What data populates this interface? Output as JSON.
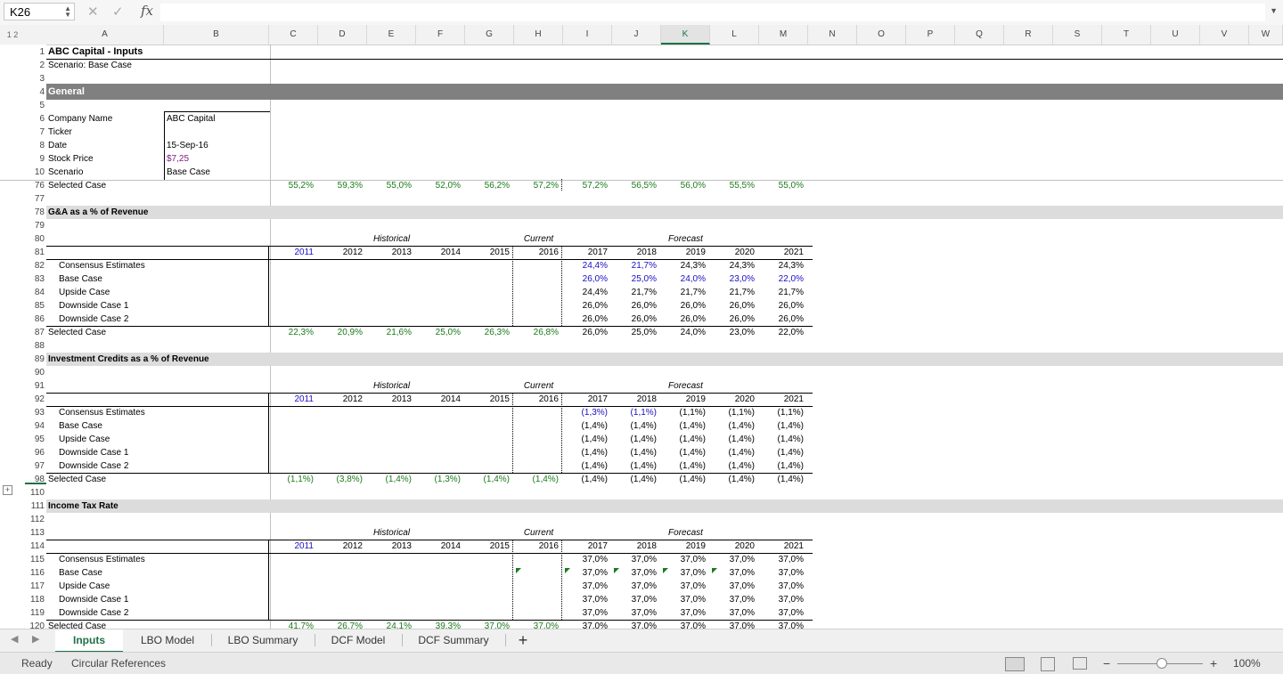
{
  "formula_bar": {
    "name_box": "K26",
    "fx": "fx"
  },
  "columns": [
    "A",
    "B",
    "C",
    "D",
    "E",
    "F",
    "G",
    "H",
    "I",
    "J",
    "K",
    "L",
    "M",
    "N",
    "O",
    "P",
    "Q",
    "R",
    "S",
    "T",
    "U",
    "V",
    "W"
  ],
  "outline_levels": "1 2",
  "frozen": {
    "title": "ABC Capital - Inputs",
    "scenario_line": "Scenario: Base Case",
    "general_header": "General",
    "fields": [
      {
        "label": "Company Name",
        "value": "ABC Capital"
      },
      {
        "label": "Ticker",
        "value": ""
      },
      {
        "label": "Date",
        "value": "15-Sep-16"
      },
      {
        "label": "Stock Price",
        "value": "$7,25"
      },
      {
        "label": "Scenario",
        "value": "Base Case"
      }
    ]
  },
  "top_selected_row": {
    "label": "Selected Case",
    "values": [
      "55,2%",
      "59,3%",
      "55,0%",
      "52,0%",
      "56,2%",
      "57,2%",
      "57,2%",
      "56,5%",
      "56,0%",
      "55,5%",
      "55,0%"
    ]
  },
  "period_labels": {
    "historical": "Historical",
    "current": "Current",
    "forecast": "Forecast"
  },
  "years": [
    "2011",
    "2012",
    "2013",
    "2014",
    "2015",
    "2016",
    "2017",
    "2018",
    "2019",
    "2020",
    "2021"
  ],
  "sections": [
    {
      "title": "G&A as a % of Revenue",
      "cases": [
        {
          "label": "Consensus Estimates",
          "values": [
            "24,4%",
            "21,7%",
            "24,3%",
            "24,3%",
            "24,3%"
          ]
        },
        {
          "label": "Base Case",
          "values": [
            "26,0%",
            "25,0%",
            "24,0%",
            "23,0%",
            "22,0%"
          ]
        },
        {
          "label": "Upside Case",
          "values": [
            "24,4%",
            "21,7%",
            "21,7%",
            "21,7%",
            "21,7%"
          ]
        },
        {
          "label": "Downside Case 1",
          "values": [
            "26,0%",
            "26,0%",
            "26,0%",
            "26,0%",
            "26,0%"
          ]
        },
        {
          "label": "Downside Case 2",
          "values": [
            "26,0%",
            "26,0%",
            "26,0%",
            "26,0%",
            "26,0%"
          ]
        }
      ],
      "selected": {
        "label": "Selected Case",
        "values": [
          "22,3%",
          "20,9%",
          "21,6%",
          "25,0%",
          "26,3%",
          "26,8%",
          "26,0%",
          "25,0%",
          "24,0%",
          "23,0%",
          "22,0%"
        ]
      }
    },
    {
      "title": "Investment Credits as a % of Revenue",
      "cases": [
        {
          "label": "Consensus Estimates",
          "values": [
            "(1,3%)",
            "(1,1%)",
            "(1,1%)",
            "(1,1%)",
            "(1,1%)"
          ]
        },
        {
          "label": "Base Case",
          "values": [
            "(1,4%)",
            "(1,4%)",
            "(1,4%)",
            "(1,4%)",
            "(1,4%)"
          ]
        },
        {
          "label": "Upside Case",
          "values": [
            "(1,4%)",
            "(1,4%)",
            "(1,4%)",
            "(1,4%)",
            "(1,4%)"
          ]
        },
        {
          "label": "Downside Case 1",
          "values": [
            "(1,4%)",
            "(1,4%)",
            "(1,4%)",
            "(1,4%)",
            "(1,4%)"
          ]
        },
        {
          "label": "Downside Case 2",
          "values": [
            "(1,4%)",
            "(1,4%)",
            "(1,4%)",
            "(1,4%)",
            "(1,4%)"
          ]
        }
      ],
      "selected": {
        "label": "Selected Case",
        "values": [
          "(1,1%)",
          "(3,8%)",
          "(1,4%)",
          "(1,3%)",
          "(1,4%)",
          "(1,4%)",
          "(1,4%)",
          "(1,4%)",
          "(1,4%)",
          "(1,4%)",
          "(1,4%)"
        ]
      }
    },
    {
      "title": "Income Tax Rate",
      "cases": [
        {
          "label": "Consensus Estimates",
          "values": [
            "37,0%",
            "37,0%",
            "37,0%",
            "37,0%",
            "37,0%"
          ]
        },
        {
          "label": "Base Case",
          "values": [
            "37,0%",
            "37,0%",
            "37,0%",
            "37,0%",
            "37,0%"
          ]
        },
        {
          "label": "Upside Case",
          "values": [
            "37,0%",
            "37,0%",
            "37,0%",
            "37,0%",
            "37,0%"
          ]
        },
        {
          "label": "Downside Case 1",
          "values": [
            "37,0%",
            "37,0%",
            "37,0%",
            "37,0%",
            "37,0%"
          ]
        },
        {
          "label": "Downside Case 2",
          "values": [
            "37,0%",
            "37,0%",
            "37,0%",
            "37,0%",
            "37,0%"
          ]
        }
      ],
      "selected": {
        "label": "Selected Case",
        "values": [
          "41,7%",
          "26,7%",
          "24,1%",
          "39,3%",
          "37,0%",
          "37,0%",
          "37,0%",
          "37,0%",
          "37,0%",
          "37,0%",
          "37,0%"
        ]
      }
    }
  ],
  "row_numbers": {
    "frozen": [
      "1",
      "2",
      "3",
      "4",
      "5",
      "6",
      "7",
      "8",
      "9",
      "10"
    ],
    "body": [
      "76",
      "77",
      "78",
      "79",
      "80",
      "81",
      "82",
      "83",
      "84",
      "85",
      "86",
      "87",
      "88",
      "89",
      "90",
      "91",
      "92",
      "93",
      "94",
      "95",
      "96",
      "97",
      "98",
      "110",
      "111",
      "112",
      "113",
      "114",
      "115",
      "116",
      "117",
      "118",
      "119",
      "120"
    ]
  },
  "sheet_tabs": [
    "Inputs",
    "LBO Model",
    "LBO Summary",
    "DCF Model",
    "DCF Summary"
  ],
  "add_sheet": "+",
  "status_bar": {
    "ready": "Ready",
    "circular": "Circular References",
    "zoom": "100%"
  },
  "colors": {
    "accent": "#1e7145",
    "input_blue": "#1a0ec4",
    "link_green": "#1a7a1a",
    "section_band": "#808080"
  }
}
